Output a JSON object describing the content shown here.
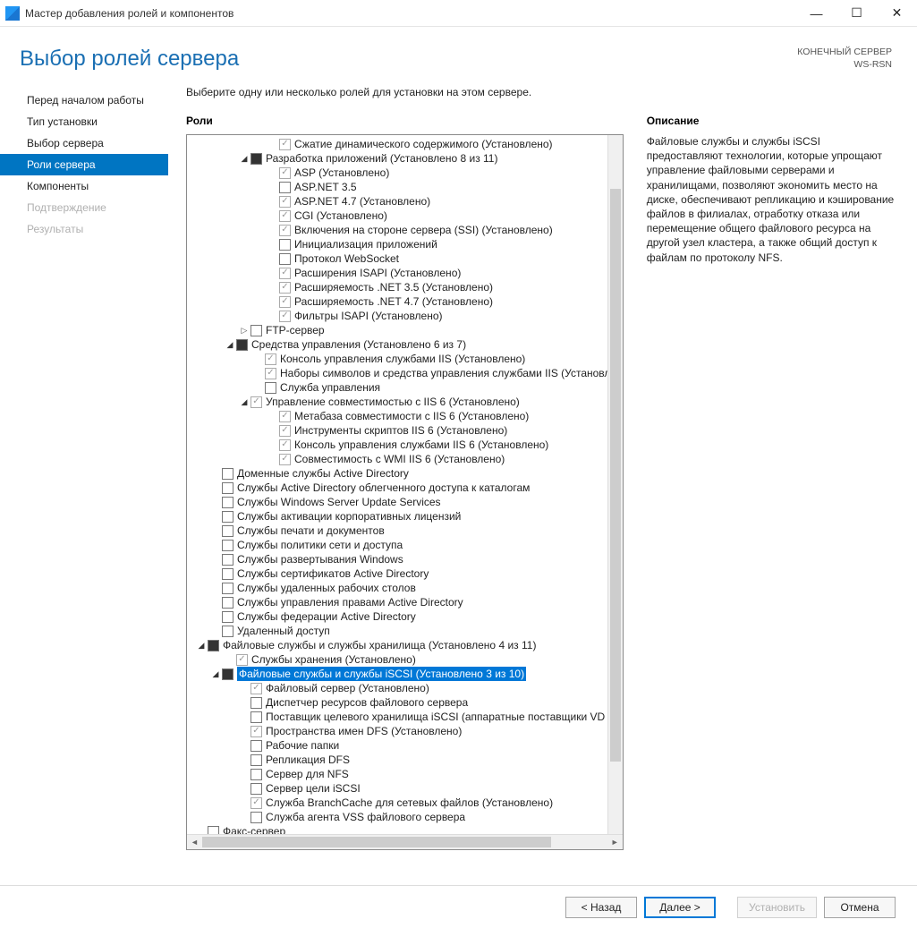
{
  "window": {
    "title": "Мастер добавления ролей и компонентов",
    "min": "—",
    "max": "☐",
    "close": "✕"
  },
  "header": {
    "page_title": "Выбор ролей сервера",
    "server_label": "КОНЕЧНЫЙ СЕРВЕР",
    "server_name": "WS-RSN"
  },
  "nav": {
    "items": [
      {
        "label": "Перед началом работы"
      },
      {
        "label": "Тип установки"
      },
      {
        "label": "Выбор сервера"
      },
      {
        "label": "Роли сервера",
        "selected": true
      },
      {
        "label": "Компоненты"
      },
      {
        "label": "Подтверждение",
        "disabled": true
      },
      {
        "label": "Результаты",
        "disabled": true
      }
    ]
  },
  "instruction": "Выберите одну или несколько ролей для установки на этом сервере.",
  "roles_heading": "Роли",
  "description_heading": "Описание",
  "description_text": "Файловые службы и службы iSCSI предоставляют технологии, которые упрощают управление файловыми серверами и хранилищами, позволяют экономить место на диске, обеспечивают репликацию и кэширование файлов в филиалах, отработку отказа или перемещение общего файлового ресурса на другой узел кластера, а также общий доступ к файлам по протоколу NFS.",
  "tree": [
    {
      "indent": 5,
      "expander": "",
      "state": "checked",
      "dim": true,
      "label": "Сжатие динамического содержимого (Установлено)"
    },
    {
      "indent": 3,
      "expander": "▾",
      "state": "partial",
      "label": "Разработка приложений (Установлено 8 из 11)"
    },
    {
      "indent": 5,
      "expander": "",
      "state": "checked",
      "dim": true,
      "label": "ASP (Установлено)"
    },
    {
      "indent": 5,
      "expander": "",
      "state": "none",
      "label": "ASP.NET 3.5"
    },
    {
      "indent": 5,
      "expander": "",
      "state": "checked",
      "dim": true,
      "label": "ASP.NET 4.7 (Установлено)"
    },
    {
      "indent": 5,
      "expander": "",
      "state": "checked",
      "dim": true,
      "label": "CGI (Установлено)"
    },
    {
      "indent": 5,
      "expander": "",
      "state": "checked",
      "dim": true,
      "label": "Включения на стороне сервера (SSI) (Установлено)"
    },
    {
      "indent": 5,
      "expander": "",
      "state": "none",
      "label": "Инициализация приложений"
    },
    {
      "indent": 5,
      "expander": "",
      "state": "none",
      "label": "Протокол WebSocket"
    },
    {
      "indent": 5,
      "expander": "",
      "state": "checked",
      "dim": true,
      "label": "Расширения ISAPI (Установлено)"
    },
    {
      "indent": 5,
      "expander": "",
      "state": "checked",
      "dim": true,
      "label": "Расширяемость .NET 3.5 (Установлено)"
    },
    {
      "indent": 5,
      "expander": "",
      "state": "checked",
      "dim": true,
      "label": "Расширяемость .NET 4.7 (Установлено)"
    },
    {
      "indent": 5,
      "expander": "",
      "state": "checked",
      "dim": true,
      "label": "Фильтры ISAPI (Установлено)"
    },
    {
      "indent": 3,
      "expander": "▹",
      "state": "none",
      "label": "FTP-сервер"
    },
    {
      "indent": 2,
      "expander": "▾",
      "state": "partial",
      "label": "Средства управления (Установлено 6 из 7)"
    },
    {
      "indent": 4,
      "expander": "",
      "state": "checked",
      "dim": true,
      "label": "Консоль управления службами IIS (Установлено)"
    },
    {
      "indent": 4,
      "expander": "",
      "state": "checked",
      "dim": true,
      "label": "Наборы символов и средства управления службами IIS (Установлен"
    },
    {
      "indent": 4,
      "expander": "",
      "state": "none",
      "label": "Служба управления"
    },
    {
      "indent": 3,
      "expander": "▾",
      "state": "checked",
      "dim": true,
      "label": "Управление совместимостью с IIS 6 (Установлено)"
    },
    {
      "indent": 5,
      "expander": "",
      "state": "checked",
      "dim": true,
      "label": "Метабаза совместимости с IIS 6 (Установлено)"
    },
    {
      "indent": 5,
      "expander": "",
      "state": "checked",
      "dim": true,
      "label": "Инструменты скриптов IIS 6 (Установлено)"
    },
    {
      "indent": 5,
      "expander": "",
      "state": "checked",
      "dim": true,
      "label": "Консоль управления службами IIS 6 (Установлено)"
    },
    {
      "indent": 5,
      "expander": "",
      "state": "checked",
      "dim": true,
      "label": "Совместимость с WMI IIS 6 (Установлено)"
    },
    {
      "indent": 1,
      "expander": "",
      "state": "none",
      "label": "Доменные службы Active Directory"
    },
    {
      "indent": 1,
      "expander": "",
      "state": "none",
      "label": "Службы Active Directory облегченного доступа к каталогам"
    },
    {
      "indent": 1,
      "expander": "",
      "state": "none",
      "label": "Службы Windows Server Update Services"
    },
    {
      "indent": 1,
      "expander": "",
      "state": "none",
      "label": "Службы активации корпоративных лицензий"
    },
    {
      "indent": 1,
      "expander": "",
      "state": "none",
      "label": "Службы печати и документов"
    },
    {
      "indent": 1,
      "expander": "",
      "state": "none",
      "label": "Службы политики сети и доступа"
    },
    {
      "indent": 1,
      "expander": "",
      "state": "none",
      "label": "Службы развертывания Windows"
    },
    {
      "indent": 1,
      "expander": "",
      "state": "none",
      "label": "Службы сертификатов Active Directory"
    },
    {
      "indent": 1,
      "expander": "",
      "state": "none",
      "label": "Службы удаленных рабочих столов"
    },
    {
      "indent": 1,
      "expander": "",
      "state": "none",
      "label": "Службы управления правами Active Directory"
    },
    {
      "indent": 1,
      "expander": "",
      "state": "none",
      "label": "Службы федерации Active Directory"
    },
    {
      "indent": 1,
      "expander": "",
      "state": "none",
      "label": "Удаленный доступ"
    },
    {
      "indent": 0,
      "expander": "▾",
      "state": "partial",
      "label": "Файловые службы и службы хранилища (Установлено 4 из 11)"
    },
    {
      "indent": 2,
      "expander": "",
      "state": "checked",
      "dim": true,
      "label": "Службы хранения (Установлено)"
    },
    {
      "indent": 1,
      "expander": "▾",
      "state": "partial",
      "label": "Файловые службы и службы iSCSI (Установлено 3 из 10)",
      "selected": true
    },
    {
      "indent": 3,
      "expander": "",
      "state": "checked",
      "dim": true,
      "label": "Файловый сервер (Установлено)"
    },
    {
      "indent": 3,
      "expander": "",
      "state": "none",
      "label": "Диспетчер ресурсов файлового сервера"
    },
    {
      "indent": 3,
      "expander": "",
      "state": "none",
      "label": "Поставщик целевого хранилища iSCSI (аппаратные поставщики VD"
    },
    {
      "indent": 3,
      "expander": "",
      "state": "checked",
      "dim": true,
      "label": "Пространства имен DFS (Установлено)"
    },
    {
      "indent": 3,
      "expander": "",
      "state": "none",
      "label": "Рабочие папки"
    },
    {
      "indent": 3,
      "expander": "",
      "state": "none",
      "label": "Репликация DFS"
    },
    {
      "indent": 3,
      "expander": "",
      "state": "none",
      "label": "Сервер для NFS"
    },
    {
      "indent": 3,
      "expander": "",
      "state": "none",
      "label": "Сервер цели iSCSI"
    },
    {
      "indent": 3,
      "expander": "",
      "state": "checked",
      "dim": true,
      "label": "Служба BranchCache для сетевых файлов (Установлено)"
    },
    {
      "indent": 3,
      "expander": "",
      "state": "none",
      "label": "Служба агента VSS файлового сервера"
    },
    {
      "indent": 0,
      "expander": "",
      "state": "none",
      "label": "Факс-сервер"
    }
  ],
  "footer": {
    "back": "< Назад",
    "next": "Далее >",
    "install": "Установить",
    "cancel": "Отмена"
  }
}
